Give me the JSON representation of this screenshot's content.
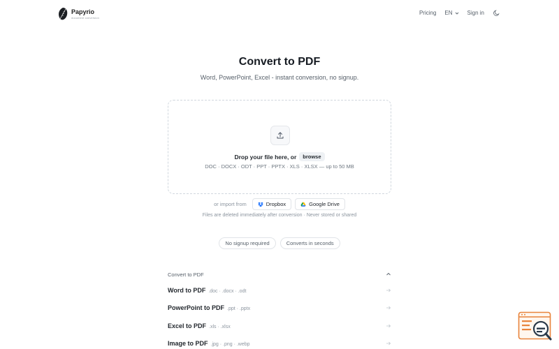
{
  "brand": {
    "name": "Papyrio",
    "tagline": "document conversion"
  },
  "nav": {
    "pricing": "Pricing",
    "language": "EN",
    "sign_in": "Sign in",
    "theme_icon": "moon-icon"
  },
  "hero": {
    "title": "Convert to PDF",
    "subtitle": "Word, PowerPoint, Excel - instant conversion, no signup."
  },
  "dropzone": {
    "icon": "upload-icon",
    "prompt": "Drop your file here, or",
    "browse_label": "browse",
    "formats": "DOC · DOCX · ODT · PPT · PPTX · XLS · XLSX — up to 50 MB"
  },
  "import": {
    "label": "or import from",
    "dropbox": "Dropbox",
    "google_drive": "Google Drive"
  },
  "privacy_note": "Files are deleted immediately after conversion · Never stored or shared",
  "pills": [
    "No signup required",
    "Converts in seconds"
  ],
  "accordion": {
    "heading": "Convert to PDF",
    "items": [
      {
        "name": "Word to PDF",
        "ext": ".doc · .docx · .odt"
      },
      {
        "name": "PowerPoint to PDF",
        "ext": ".ppt · .pptx"
      },
      {
        "name": "Excel to PDF",
        "ext": ".xls · .xlsx"
      },
      {
        "name": "Image to PDF",
        "ext": ".jpg · .png · .webp"
      }
    ]
  },
  "colors": {
    "accent_widget": "#e8843c",
    "dropbox_blue": "#0061fe",
    "text_primary": "#24292f",
    "text_muted": "#8c959f"
  }
}
